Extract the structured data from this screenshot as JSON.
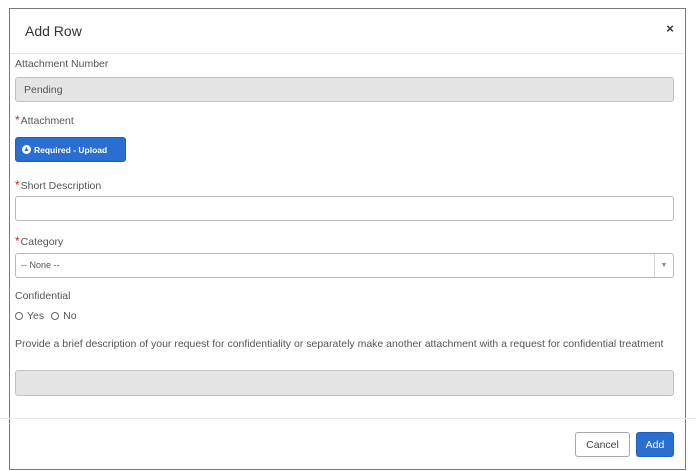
{
  "dialog": {
    "title": "Add Row",
    "close_symbol": "×"
  },
  "fields": {
    "attachment_number": {
      "label": "Attachment Number",
      "value": "Pending"
    },
    "attachment": {
      "required_mark": "*",
      "label": "Attachment",
      "upload_button": "Required - Upload",
      "upload_icon": "upload-circle-icon"
    },
    "short_description": {
      "required_mark": "*",
      "label": "Short Description",
      "value": ""
    },
    "category": {
      "required_mark": "*",
      "label": "Category",
      "selected": "-- None --",
      "arrow": "▼"
    },
    "confidential": {
      "label": "Confidential",
      "options": [
        "Yes",
        "No"
      ]
    },
    "confidential_description": {
      "label": "Provide a brief description of your request for confidentiality or separately make another attachment with a request for confidential treatment",
      "value": ""
    }
  },
  "footer": {
    "cancel_label": "Cancel",
    "add_label": "Add"
  },
  "colors": {
    "primary": "#2a6ed1",
    "required": "#cc1f1f",
    "readonly_bg": "#e5e5e5"
  }
}
